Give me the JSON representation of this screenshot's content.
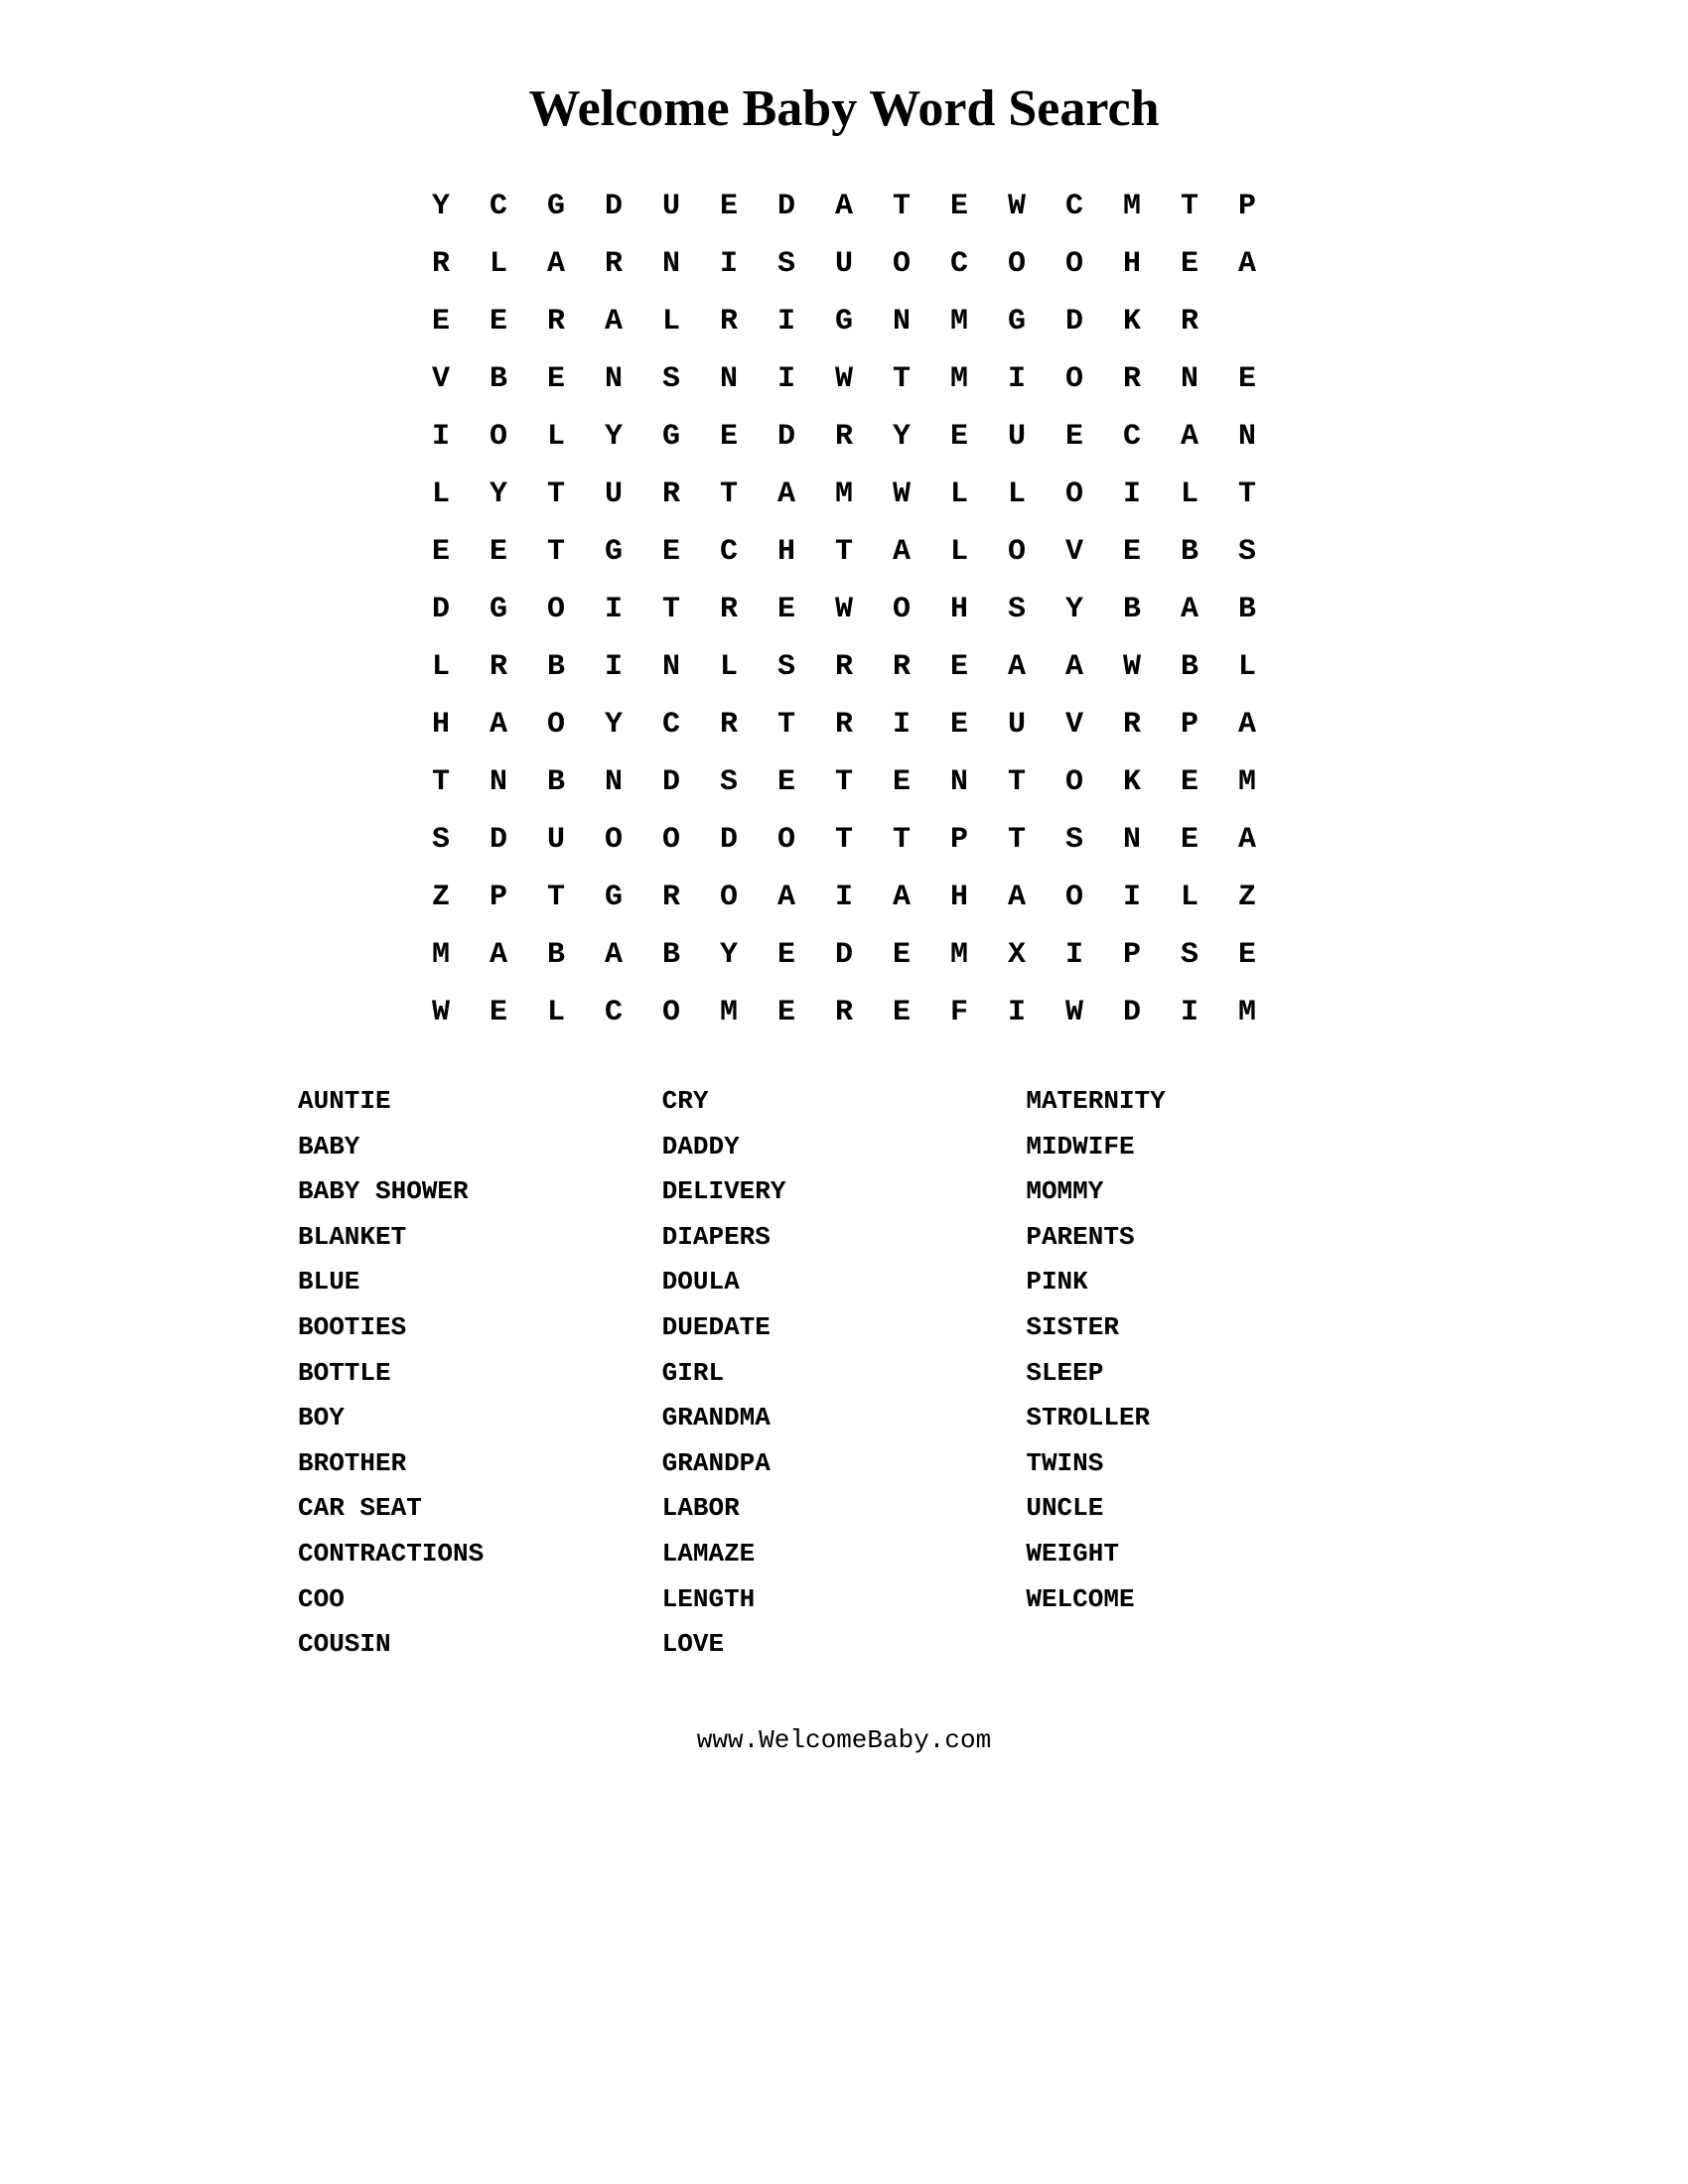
{
  "title": "Welcome Baby Word Search",
  "grid": [
    [
      "Y",
      "C",
      "G",
      "D",
      "U",
      "E",
      "D",
      "A",
      "T",
      "E",
      "W",
      "C",
      "M",
      "T",
      "P"
    ],
    [
      "R",
      "L",
      "A",
      "R",
      "N",
      "I",
      "S",
      "U",
      "O",
      "C",
      "O",
      "O",
      "H",
      "E",
      "A"
    ],
    [
      "E",
      "E",
      "R",
      "A",
      "L",
      "R",
      "I",
      "G",
      "N",
      "M",
      "G",
      "D",
      "K",
      "R",
      ""
    ],
    [
      "V",
      "B",
      "E",
      "N",
      "S",
      "N",
      "I",
      "W",
      "T",
      "M",
      "I",
      "O",
      "R",
      "N",
      "E"
    ],
    [
      "I",
      "O",
      "L",
      "Y",
      "G",
      "E",
      "D",
      "R",
      "Y",
      "E",
      "U",
      "E",
      "C",
      "A",
      "N"
    ],
    [
      "L",
      "Y",
      "T",
      "U",
      "R",
      "T",
      "A",
      "M",
      "W",
      "L",
      "L",
      "O",
      "I",
      "L",
      "T"
    ],
    [
      "E",
      "E",
      "T",
      "G",
      "E",
      "C",
      "H",
      "T",
      "A",
      "L",
      "O",
      "V",
      "E",
      "B",
      "S"
    ],
    [
      "D",
      "G",
      "O",
      "I",
      "T",
      "R",
      "E",
      "W",
      "O",
      "H",
      "S",
      "Y",
      "B",
      "A",
      "B"
    ],
    [
      "L",
      "R",
      "B",
      "I",
      "N",
      "L",
      "S",
      "R",
      "R",
      "E",
      "A",
      "A",
      "W",
      "B",
      "L"
    ],
    [
      "H",
      "A",
      "O",
      "Y",
      "C",
      "R",
      "T",
      "R",
      "I",
      "E",
      "U",
      "V",
      "R",
      "P",
      "A"
    ],
    [
      "T",
      "N",
      "B",
      "N",
      "D",
      "S",
      "E",
      "T",
      "E",
      "N",
      "T",
      "O",
      "K",
      "E",
      "M"
    ],
    [
      "S",
      "D",
      "U",
      "O",
      "O",
      "D",
      "O",
      "T",
      "T",
      "P",
      "T",
      "S",
      "N",
      "E",
      "A"
    ],
    [
      "Z",
      "P",
      "T",
      "G",
      "R",
      "O",
      "A",
      "I",
      "A",
      "H",
      "A",
      "O",
      "I",
      "L",
      "Z"
    ],
    [
      "M",
      "A",
      "B",
      "A",
      "B",
      "Y",
      "E",
      "D",
      "E",
      "M",
      "X",
      "I",
      "P",
      "S",
      "E"
    ],
    [
      "W",
      "E",
      "L",
      "C",
      "O",
      "M",
      "E",
      "R",
      "E",
      "F",
      "I",
      "W",
      "D",
      "I",
      "M"
    ]
  ],
  "words": {
    "col1": [
      "AUNTIE",
      "BABY",
      "BABY SHOWER",
      "BLANKET",
      "BLUE",
      "BOOTIES",
      "BOTTLE",
      "BOY",
      "BROTHER",
      "CAR SEAT",
      "CONTRACTIONS",
      "COO",
      "COUSIN"
    ],
    "col2": [
      "CRY",
      "DADDY",
      "DELIVERY",
      "DIAPERS",
      "DOULA",
      "DUEDATE",
      "GIRL",
      "GRANDMA",
      "GRANDPA",
      "LABOR",
      "LAMAZE",
      "LENGTH",
      "LOVE"
    ],
    "col3": [
      "MATERNITY",
      "MIDWIFE",
      "MOMMY",
      "PARENTS",
      "PINK",
      "SISTER",
      "SLEEP",
      "STROLLER",
      "TWINS",
      "UNCLE",
      "WEIGHT",
      "WELCOME"
    ]
  },
  "footer": "www.WelcomeBaby.com"
}
